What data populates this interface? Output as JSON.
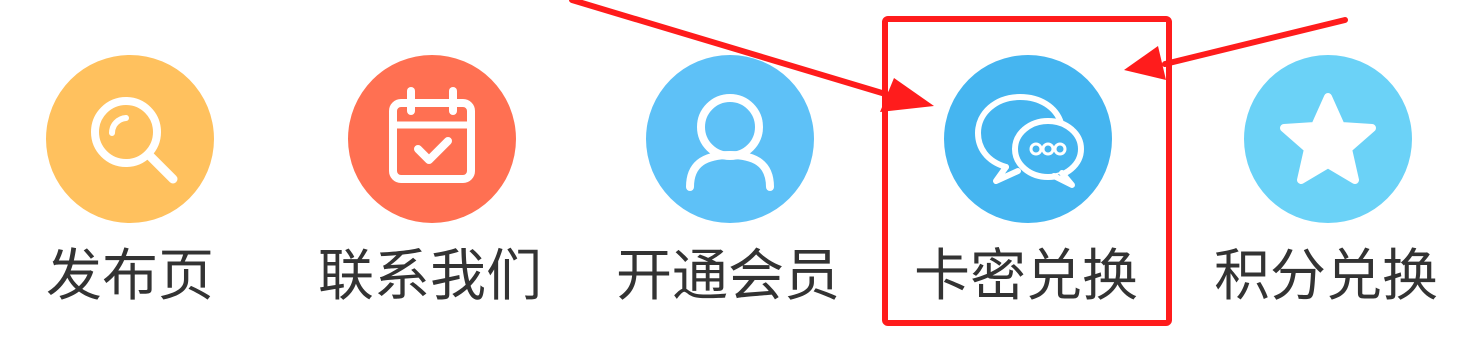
{
  "menu": {
    "items": [
      {
        "label": "发布页",
        "icon": "search-icon",
        "color": "#FFC15E"
      },
      {
        "label": "联系我们",
        "icon": "calendar-check-icon",
        "color": "#FF7052"
      },
      {
        "label": "开通会员",
        "icon": "user-icon",
        "color": "#5EC1F7"
      },
      {
        "label": "卡密兑换",
        "icon": "chat-bubbles-icon",
        "color": "#45B5F0"
      },
      {
        "label": "积分兑换",
        "icon": "star-icon",
        "color": "#6BD2F7"
      }
    ]
  },
  "annotation": {
    "highlight_color": "#FF1C1C",
    "target": "卡密兑换"
  }
}
